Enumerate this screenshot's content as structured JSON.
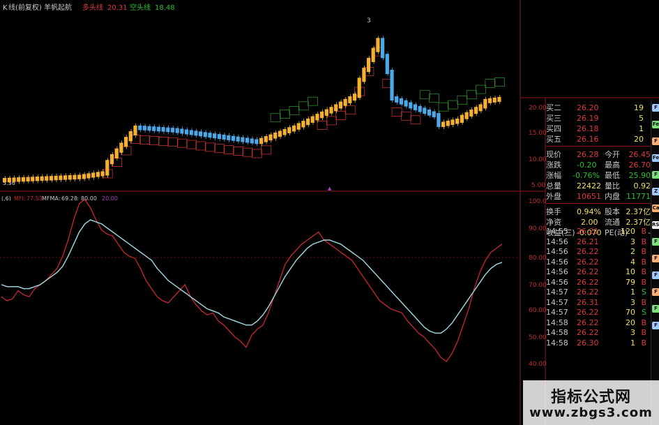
{
  "header": {
    "title": "(前复权) 羊帆起航",
    "title_prefix": "K",
    "title_middle": "线",
    "indicator1_label": "多头线",
    "indicator1_value": "20.31",
    "indicator2_label": "空头线",
    "indicator2_value": "18.48",
    "peak_marker": "3"
  },
  "price_axis": {
    "ticks": [
      "20.00",
      "15.00",
      "10.00",
      "5.00"
    ],
    "low_marker": "5.56"
  },
  "indicator_header": {
    "prefix": "(,6)",
    "mfi_label": "MFI:",
    "mfi_value": "77.53",
    "mfma_label": "MFMA:",
    "mfma_value": "69.28",
    "level1": "80.00",
    "level2": "20.00"
  },
  "indicator_axis": {
    "ticks": [
      "100.0",
      "90.00",
      "80.00",
      "70.00",
      "60.00",
      "50.00",
      "40.00"
    ]
  },
  "quote": {
    "bids": [
      {
        "label": "买二",
        "price": "26.20",
        "vol": "19"
      },
      {
        "label": "买三",
        "price": "26.19",
        "vol": "5"
      },
      {
        "label": "买四",
        "price": "26.18",
        "vol": "1"
      },
      {
        "label": "买五",
        "price": "26.16",
        "vol": "20"
      }
    ],
    "stats": [
      {
        "l1": "现价",
        "v1": "26.28",
        "l2": "今开",
        "v2": "26.45"
      },
      {
        "l1": "涨跌",
        "v1": "-0.20",
        "l2": "最高",
        "v2": "26.70"
      },
      {
        "l1": "涨幅",
        "v1": "-0.76%",
        "l2": "最低",
        "v2": "25.90"
      },
      {
        "l1": "总量",
        "v1": "22422",
        "l2": "量比",
        "v2": "0.92"
      },
      {
        "l1": "外盘",
        "v1": "10651",
        "l2": "内盘",
        "v2": "11771"
      }
    ],
    "extra": [
      {
        "l1": "换手",
        "v1": "0.94%",
        "l2": "股本",
        "v2": "2.37亿"
      },
      {
        "l1": "净资",
        "v1": "2.00",
        "l2": "流通",
        "v2": "2.37亿"
      },
      {
        "l1": "收益(三)",
        "v1": "-0.070",
        "l2": "PE(动)",
        "v2": "-"
      }
    ]
  },
  "trades": [
    {
      "time": "14:55",
      "price": "26.21",
      "vol": "120",
      "side": "B"
    },
    {
      "time": "14:56",
      "price": "26.21",
      "vol": "3",
      "side": "B"
    },
    {
      "time": "14:56",
      "price": "26.22",
      "vol": "2",
      "side": "B"
    },
    {
      "time": "14:56",
      "price": "26.22",
      "vol": "4",
      "side": "B"
    },
    {
      "time": "14:56",
      "price": "26.22",
      "vol": "10",
      "side": "B"
    },
    {
      "time": "14:56",
      "price": "26.22",
      "vol": "79",
      "side": "B"
    },
    {
      "time": "14:57",
      "price": "26.22",
      "vol": "1",
      "side": "S"
    },
    {
      "time": "14:57",
      "price": "26.31",
      "vol": "3",
      "side": "B"
    },
    {
      "time": "14:57",
      "price": "26.22",
      "vol": "70",
      "side": "S"
    },
    {
      "time": "14:58",
      "price": "26.22",
      "vol": "20",
      "side": "B"
    },
    {
      "time": "14:58",
      "price": "26.22",
      "vol": "3",
      "side": "B"
    },
    {
      "time": "14:58",
      "price": "26.30",
      "vol": "1",
      "side": "B"
    }
  ],
  "toolbar_icons": [
    "F",
    "Fe",
    "F",
    "Fe",
    "F",
    "Z",
    "Ca",
    "RSI",
    "F",
    "F",
    "F",
    "F",
    "F",
    "F"
  ],
  "watermark": {
    "title": "指标公式网",
    "url": "www.zbgs3.com"
  },
  "colors": {
    "up_candle": "#f5b030",
    "down_candle": "#4aa8e8",
    "mfi_line": "#c8282d",
    "mfma_line": "#9ad0d8",
    "grid_red": "#6a1010",
    "bull_trail": "#c03030",
    "bear_trail": "#2a8a2a",
    "price_red": "#e03a3a",
    "price_green": "#28c028"
  }
}
